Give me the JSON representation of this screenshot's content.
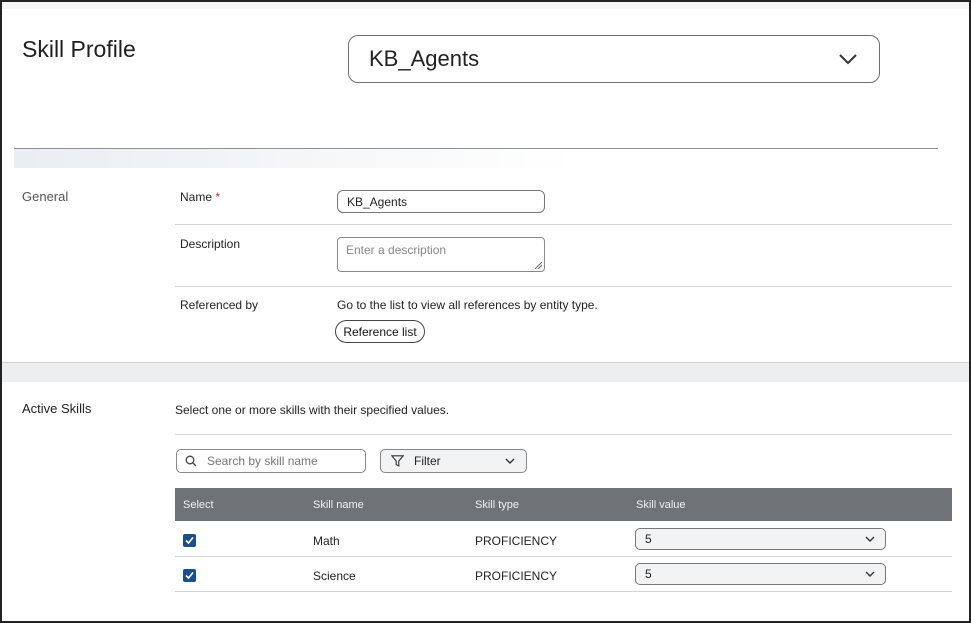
{
  "header": {
    "title": "Skill Profile",
    "profile_select": {
      "value": "KB_Agents",
      "icon": "chevron-down-icon"
    }
  },
  "general": {
    "section_label": "General",
    "name": {
      "label": "Name",
      "required_mark": "*",
      "value": "KB_Agents"
    },
    "description": {
      "label": "Description",
      "placeholder": "Enter a description"
    },
    "referenced_by": {
      "label": "Referenced by",
      "text": "Go to the list to view all references by entity type.",
      "button_label": "Reference list"
    }
  },
  "active_skills": {
    "section_label": "Active Skills",
    "instruction": "Select one or more skills with their specified values.",
    "search": {
      "placeholder": "Search by skill name",
      "icon": "search-icon"
    },
    "filter": {
      "label": "Filter",
      "icon": "filter-icon"
    },
    "table": {
      "columns": [
        "Select",
        "Skill name",
        "Skill type",
        "Skill value"
      ],
      "rows": [
        {
          "selected": true,
          "name": "Math",
          "type": "PROFICIENCY",
          "value": "5"
        },
        {
          "selected": true,
          "name": "Science",
          "type": "PROFICIENCY",
          "value": "5"
        }
      ]
    }
  },
  "colors": {
    "checkbox": "#1b4f8a",
    "table_header": "#6e7378",
    "required": "#c0392b"
  }
}
